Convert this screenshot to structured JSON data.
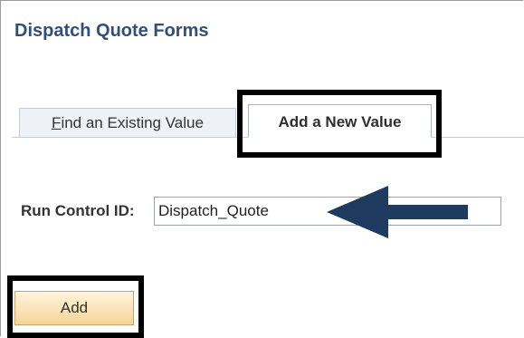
{
  "page": {
    "title": "Dispatch Quote Forms"
  },
  "tabs": [
    {
      "label_prefix": "F",
      "label_rest": "ind an Existing Value",
      "active": false
    },
    {
      "label": "Add a New Value",
      "active": true
    }
  ],
  "form": {
    "run_control_label": "Run Control ID:",
    "run_control_value": "Dispatch_Quote"
  },
  "actions": {
    "add_label": "Add"
  },
  "annotations": {
    "highlight_color": "#000000",
    "arrow_color": "#1f3a5f",
    "arrow_icon": "arrow-left-icon"
  },
  "colors": {
    "title": "#2f4f7f",
    "button_bg": "#f7d596"
  }
}
